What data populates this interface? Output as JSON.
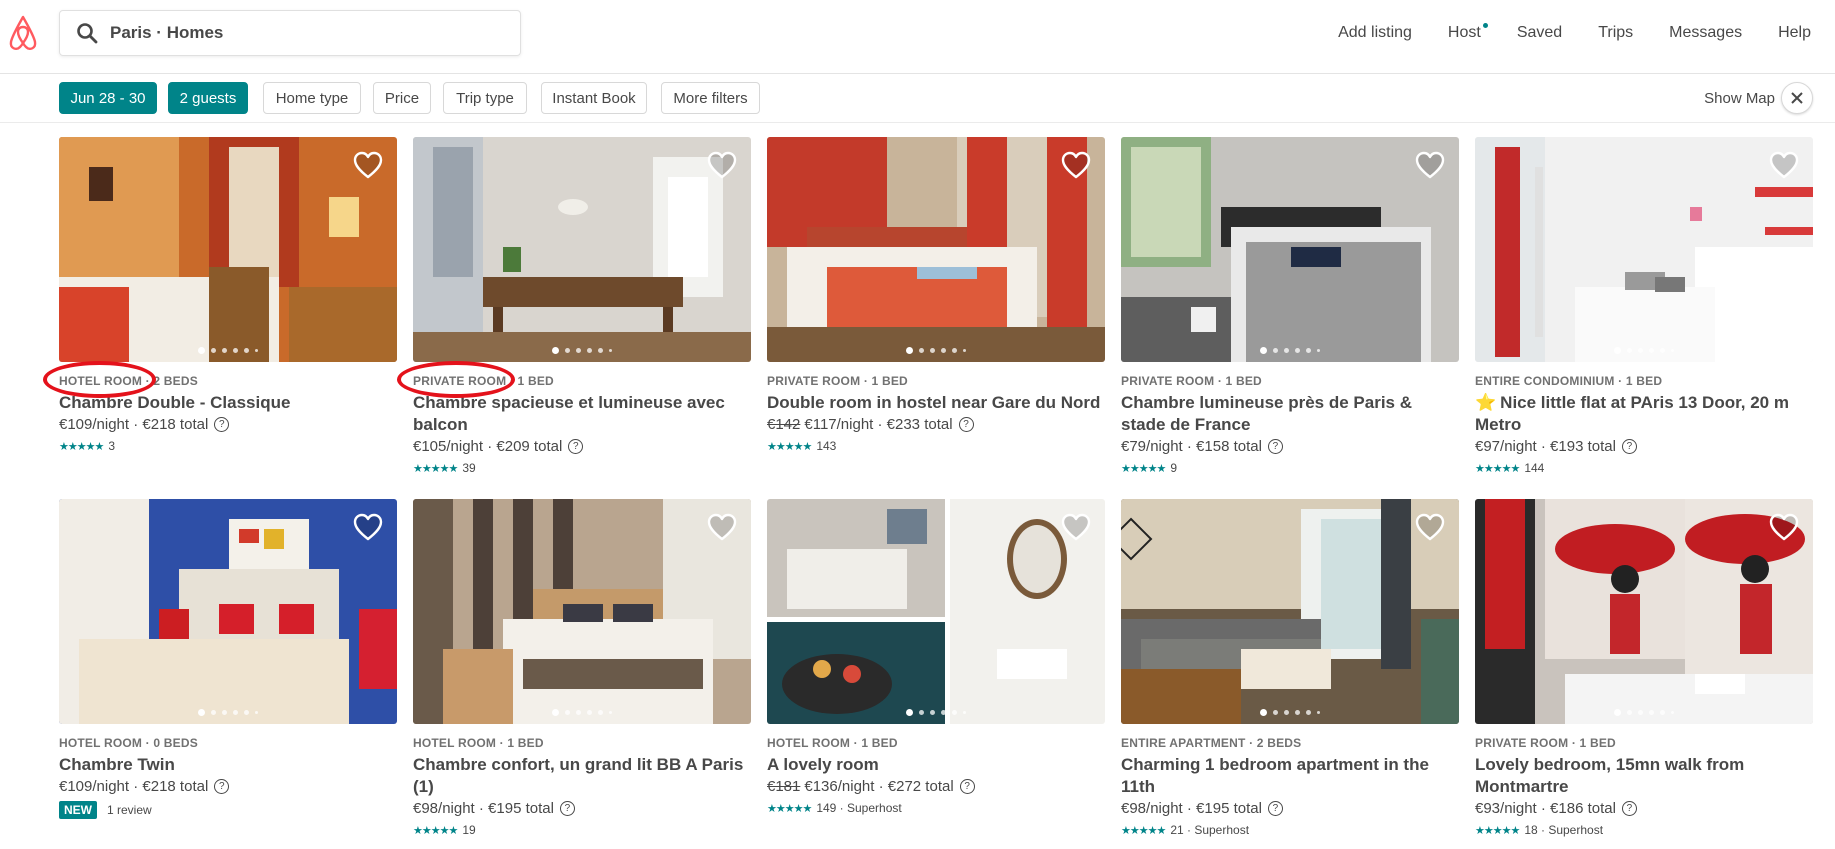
{
  "header": {
    "search_text": "Paris · Homes",
    "nav": [
      "Add listing",
      "Host",
      "Saved",
      "Trips",
      "Messages",
      "Help"
    ]
  },
  "filters": {
    "chips": [
      "Jun 28 - 30",
      "2 guests",
      "Home type",
      "Price",
      "Trip type",
      "Instant Book",
      "More filters"
    ],
    "show_map": "Show Map"
  },
  "colors": {
    "accent": "#008489",
    "brand": "#FF5A5F",
    "annotation": "#E4121B"
  },
  "listings": [
    {
      "meta": "HOTEL ROOM · 2 BEDS",
      "title": "Chambre Double - Classique",
      "old_price": "",
      "price": "€109/night · €218 total",
      "stars": "★★★★★",
      "rating": "3",
      "new": false,
      "photo": "bedroom-orange"
    },
    {
      "meta": "PRIVATE ROOM · 1 BED",
      "title": "Chambre spacieuse et lumineuse avec balcon",
      "old_price": "",
      "price": "€105/night · €209 total",
      "stars": "★★★★★",
      "rating": "39",
      "new": false,
      "photo": "dining-room"
    },
    {
      "meta": "PRIVATE ROOM · 1 BED",
      "title": "Double room in hostel near Gare du Nord",
      "old_price": "€142",
      "price": "€117/night · €233 total",
      "stars": "★★★★★",
      "rating": "143",
      "new": false,
      "photo": "bedroom-red"
    },
    {
      "meta": "PRIVATE ROOM · 1 BED",
      "title": "Chambre lumineuse près de Paris & stade de France",
      "old_price": "",
      "price": "€79/night · €158 total",
      "stars": "★★★★★",
      "rating": "9",
      "new": false,
      "photo": "bedroom-gray"
    },
    {
      "meta": "ENTIRE CONDOMINIUM · 1 BED",
      "title": "Nice little flat at PAris 13 Door, 20 m Metro",
      "old_price": "",
      "price": "€97/night · €193 total",
      "stars": "★★★★★",
      "rating": "144",
      "new": false,
      "photo": "flat-white",
      "title_star": true
    },
    {
      "meta": "HOTEL ROOM · 0 BEDS",
      "title": "Chambre Twin",
      "old_price": "",
      "price": "€109/night · €218 total",
      "stars": "",
      "rating": "1 review",
      "new": true,
      "new_label": "NEW",
      "photo": "twin-blue"
    },
    {
      "meta": "HOTEL ROOM · 1 BED",
      "title": "Chambre confort, un grand lit BB A Paris (1)",
      "old_price": "",
      "price": "€98/night · €195 total",
      "stars": "★★★★★",
      "rating": "19",
      "new": false,
      "photo": "bedroom-stripes"
    },
    {
      "meta": "HOTEL ROOM · 1 BED",
      "title": "A lovely room",
      "old_price": "€181",
      "price": "€136/night · €272 total",
      "stars": "★★★★★",
      "rating": "149 · Superhost",
      "new": false,
      "photo": "collage"
    },
    {
      "meta": "ENTIRE APARTMENT · 2 BEDS",
      "title": "Charming 1 bedroom apartment in the 11th",
      "old_price": "",
      "price": "€98/night · €195 total",
      "stars": "★★★★★",
      "rating": "21 · Superhost",
      "new": false,
      "photo": "living-room"
    },
    {
      "meta": "PRIVATE ROOM · 1 BED",
      "title": "Lovely bedroom, 15mn walk from Montmartre",
      "old_price": "",
      "price": "€93/night · €186 total",
      "stars": "★★★★★",
      "rating": "18 · Superhost",
      "new": false,
      "photo": "bedroom-red-mural"
    }
  ]
}
